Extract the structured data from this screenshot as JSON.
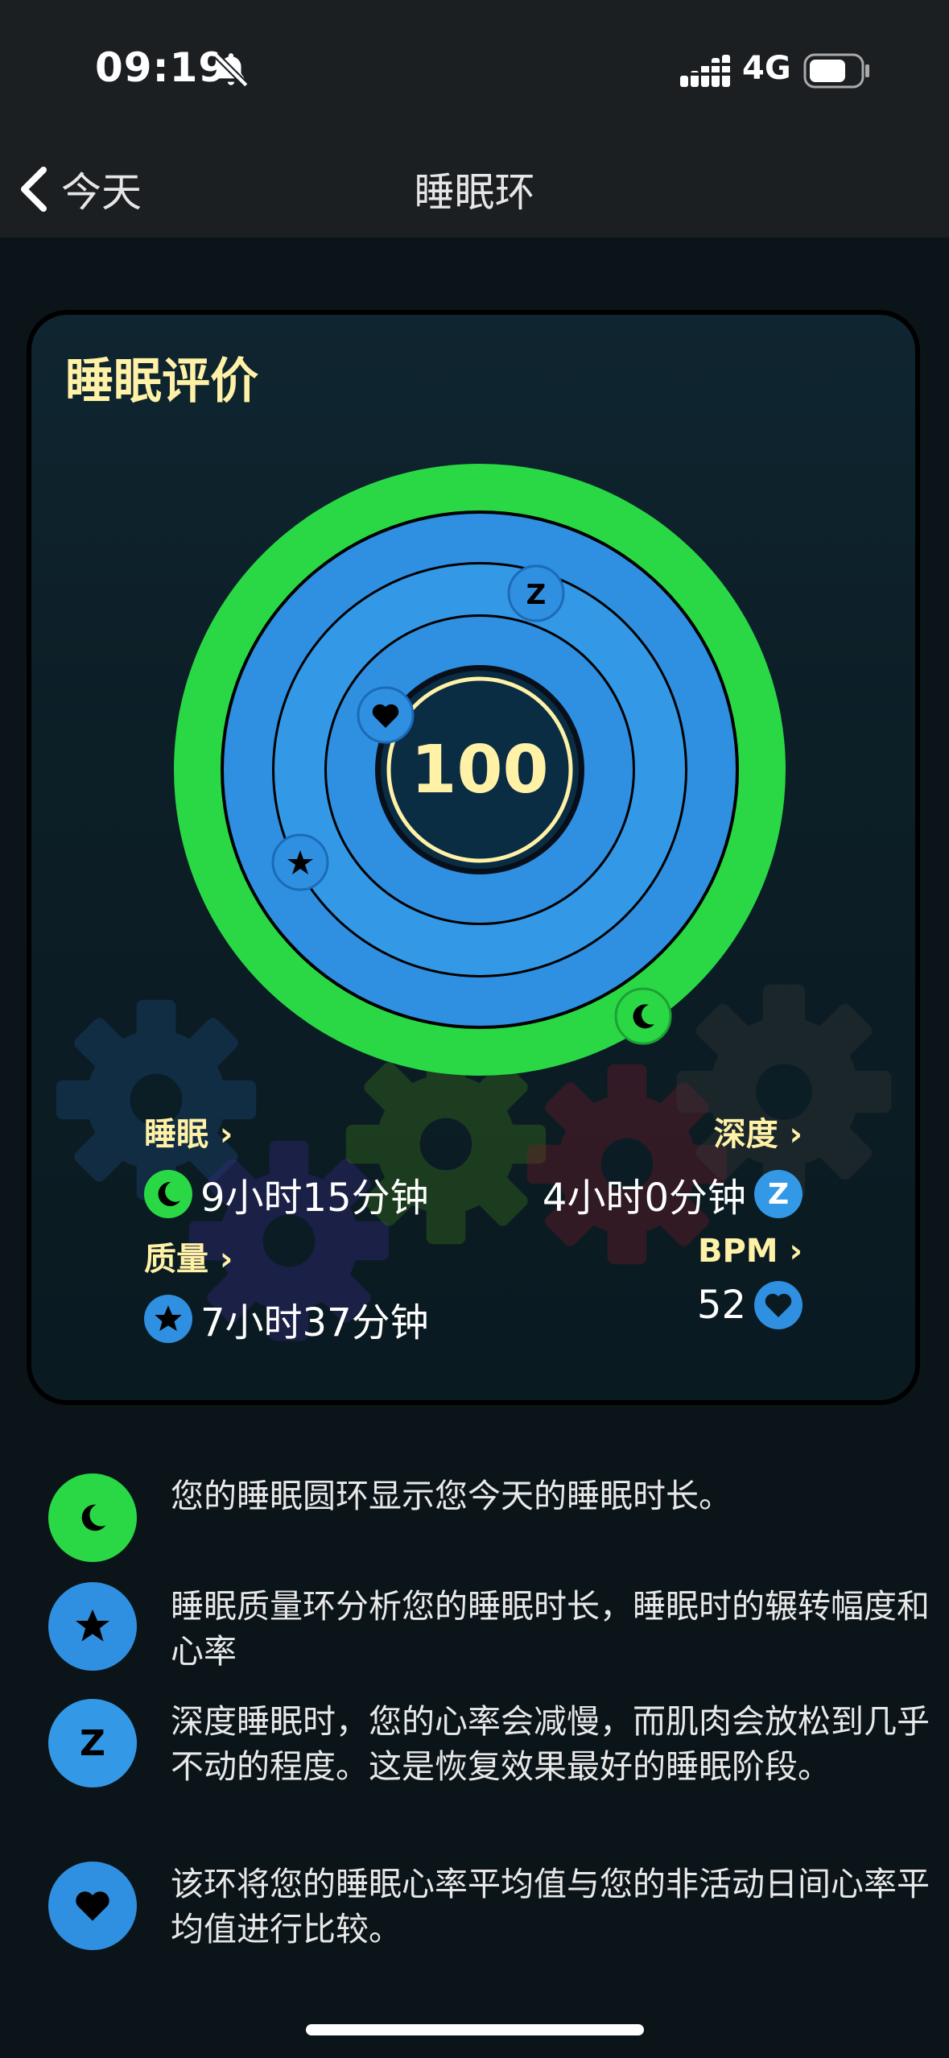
{
  "status_bar": {
    "time": "09:19",
    "network": "4G",
    "icons": [
      "bell-slash-icon",
      "signal-icon",
      "battery-icon"
    ]
  },
  "nav": {
    "back_label": "今天",
    "title": "睡眠环"
  },
  "card": {
    "title": "睡眠评价",
    "score": "100",
    "stats": {
      "sleep": {
        "label": "睡眠 ›",
        "value": "9小时15分钟",
        "icon": "moon-icon"
      },
      "deep": {
        "label": "深度 ›",
        "value": "4小时0分钟",
        "icon": "z-icon"
      },
      "quality": {
        "label": "质量 ›",
        "value": "7小时37分钟",
        "icon": "star-icon"
      },
      "bpm": {
        "label": "BPM ›",
        "value": "52",
        "icon": "heart-icon"
      }
    },
    "ring_marker_letter": "Z"
  },
  "legend": [
    {
      "icon": "moon-icon",
      "text": "您的睡眠圆环显示您今天的睡眠时长。"
    },
    {
      "icon": "star-icon",
      "text": "睡眠质量环分析您的睡眠时长，睡眠时的辗转幅度和心率"
    },
    {
      "icon": "z-icon",
      "text": "深度睡眠时，您的心率会减慢，而肌肉会放松到几乎不动的程度。这是恢复效果最好的睡眠阶段。"
    },
    {
      "icon": "heart-icon",
      "text": "该环将您的睡眠心率平均值与您的非活动日间心率平均值进行比较。"
    }
  ],
  "colors": {
    "green": "#2ad846",
    "blue": "#2f8fe0",
    "yellow": "#fff1a6"
  }
}
